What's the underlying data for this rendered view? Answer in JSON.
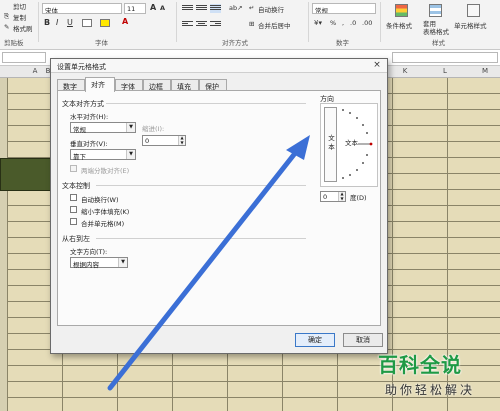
{
  "ribbon": {
    "clipboard": {
      "cut": "剪切",
      "copy": "复制",
      "format_painter": "格式刷",
      "group": "剪贴板"
    },
    "font": {
      "name": "宋体",
      "size": "11",
      "group": "字体",
      "bold": "B",
      "italic": "I",
      "underline": "U",
      "grow": "A",
      "shrink": "A"
    },
    "alignment": {
      "wrap_text": "自动换行",
      "merge_center": "合并后居中",
      "group": "对齐方式"
    },
    "number": {
      "format": "常规",
      "group": "数字",
      "percent": "%",
      "comma": ",",
      "dec_inc": ".0",
      "dec_dec": ".00"
    },
    "styles": {
      "conditional": "条件格式",
      "table_format": "套用\n表格格式",
      "cell_styles": "单元格样式",
      "group": "样式"
    }
  },
  "sheet": {
    "columns": [
      "A",
      "B",
      "K",
      "L",
      "M"
    ],
    "accent_cell_color": "#4a5a2a",
    "grid_fill": "#e5dcb8"
  },
  "dialog": {
    "title": "设置单元格格式",
    "close": "×",
    "tabs": [
      "数字",
      "对齐",
      "字体",
      "边框",
      "填充",
      "保护"
    ],
    "active_tab": "对齐",
    "text_alignment": {
      "section": "文本对齐方式",
      "horizontal_label": "水平对齐(H):",
      "horizontal_value": "常规",
      "indent_label": "缩进(I):",
      "indent_value": "0",
      "vertical_label": "垂直对齐(V):",
      "vertical_value": "靠下",
      "justify_distributed": "两端分散对齐(E)"
    },
    "text_control": {
      "section": "文本控制",
      "wrap": "自动换行(W)",
      "shrink": "缩小字体填充(K)",
      "merge": "合并单元格(M)"
    },
    "rtl": {
      "section": "从右到左",
      "direction_label": "文字方向(T):",
      "direction_value": "根据内容"
    },
    "orientation": {
      "section": "方向",
      "vertical_text": "文本",
      "dial_text": "文本",
      "degrees_value": "0",
      "degrees_label": "度(D)"
    },
    "ok": "确定",
    "cancel": "取消"
  },
  "annotation": {
    "arrow_color": "#3b6fd6"
  },
  "watermark": {
    "title": "百科全说",
    "subtitle": "助你轻松解决"
  }
}
